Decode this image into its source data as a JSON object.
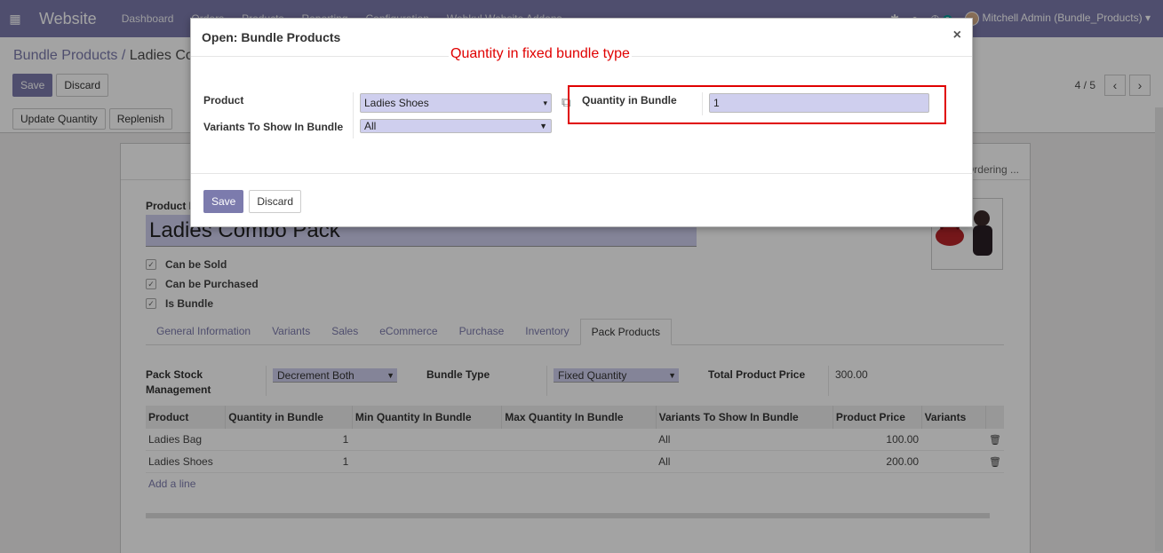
{
  "navbar": {
    "app_name": "Website",
    "menu": [
      "Dashboard",
      "Orders",
      "Products",
      "Reporting",
      "Configuration",
      "Webkul Website Addons"
    ],
    "message_count": "2",
    "user": "Mitchell Admin (Bundle_Products)"
  },
  "breadcrumb": {
    "parent": "Bundle Products",
    "separator": "/",
    "current": "Ladies Combo Pack"
  },
  "control": {
    "save": "Save",
    "discard": "Discard",
    "pager": "4 / 5"
  },
  "status_buttons": {
    "update_quantity": "Update Quantity",
    "replenish": "Replenish"
  },
  "sheet": {
    "ordering_text": "Ordering ...",
    "product_name_label": "Product Name",
    "product_name": "Ladies Combo Pack",
    "checks": [
      "Can be Sold",
      "Can be Purchased",
      "Is Bundle"
    ],
    "tabs": [
      "General Information",
      "Variants",
      "Sales",
      "eCommerce",
      "Purchase",
      "Inventory",
      "Pack Products"
    ],
    "active_tab": "Pack Products",
    "pack_stock_label_1": "Pack Stock",
    "pack_stock_label_2": "Management",
    "pack_stock_value": "Decrement Both",
    "bundle_type_label": "Bundle Type",
    "bundle_type_value": "Fixed Quantity",
    "total_price_label": "Total Product Price",
    "total_price_value": "300.00",
    "table": {
      "headers": [
        "Product",
        "Quantity in Bundle",
        "Min Quantity In Bundle",
        "Max Quantity In Bundle",
        "Variants To Show In Bundle",
        "Product Price",
        "Variants"
      ],
      "rows": [
        {
          "product": "Ladies Bag",
          "qty": "1",
          "min": "",
          "max": "",
          "variants_show": "All",
          "price": "100.00",
          "variants": ""
        },
        {
          "product": "Ladies Shoes",
          "qty": "1",
          "min": "",
          "max": "",
          "variants_show": "All",
          "price": "200.00",
          "variants": ""
        }
      ],
      "add_line": "Add a line"
    }
  },
  "modal": {
    "title": "Open: Bundle Products",
    "close": "×",
    "annotation": "Quantity in fixed bundle type",
    "product_label": "Product",
    "product_value": "Ladies Shoes",
    "variants_label": "Variants To Show In Bundle",
    "variants_value": "All",
    "qty_label": "Quantity in Bundle",
    "qty_value": "1",
    "save": "Save",
    "discard": "Discard"
  },
  "colors": {
    "brand": "#7c7bad",
    "highlight": "#e00000",
    "input_bg": "#cfcfee"
  }
}
